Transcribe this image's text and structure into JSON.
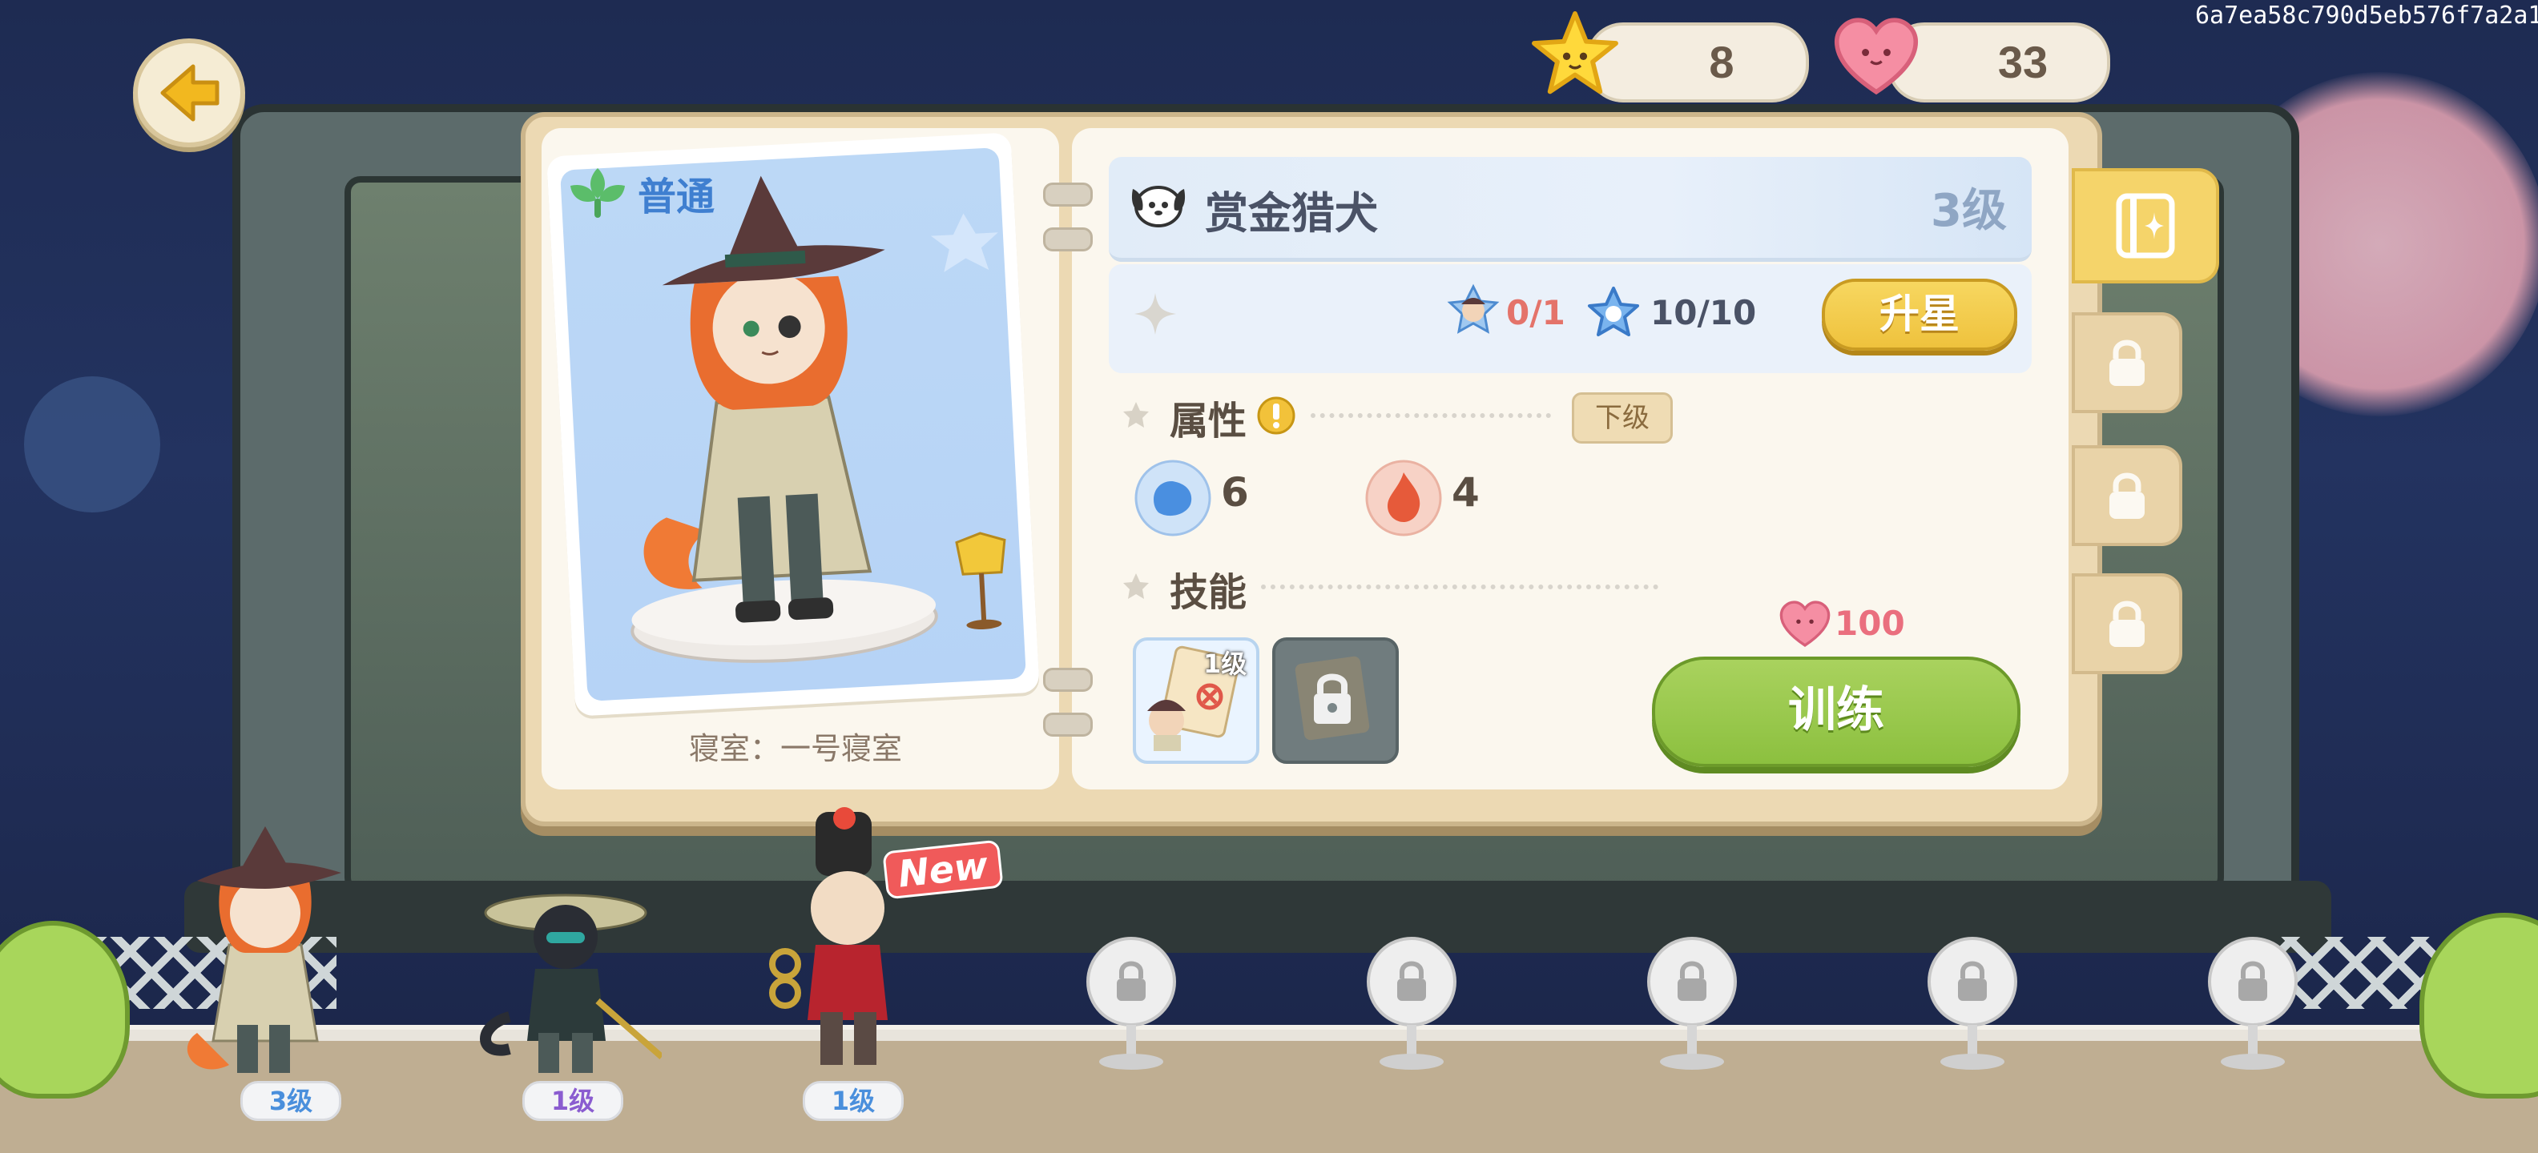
{
  "hud": {
    "stars": "8",
    "hearts": "33",
    "hash": "6a7ea58c790d5eb576f7a2a1"
  },
  "card": {
    "rarity": "普通",
    "dorm": "寝室：一号寝室"
  },
  "character": {
    "name": "赏金猎犬",
    "level": "3级",
    "shards": "0/1",
    "star_progress": "10/10",
    "upgrade_star_label": "升星"
  },
  "attributes": {
    "label": "属性",
    "lower_label": "下级",
    "water": "6",
    "fire": "4"
  },
  "skills": {
    "label": "技能",
    "skill1_level": "1级"
  },
  "training": {
    "cost": "100",
    "label": "训练"
  },
  "roster": [
    {
      "level": "3级",
      "color": "#4a8fdc"
    },
    {
      "level": "1级",
      "color": "#8a5cd0"
    },
    {
      "level": "1级",
      "color": "#4a8fdc"
    }
  ],
  "new_badge": "New",
  "colors": {
    "accent_yellow": "#efc23d",
    "accent_green": "#8cc03f",
    "heart_pink": "#ea6f7e"
  }
}
